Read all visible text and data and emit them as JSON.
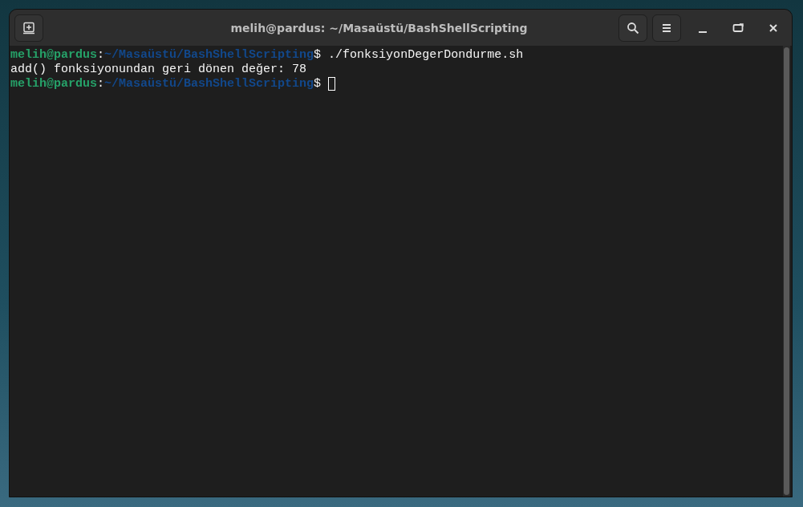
{
  "window": {
    "title": "melih@pardus: ~/Masaüstü/BashShellScripting"
  },
  "terminal": {
    "lines": [
      {
        "kind": "prompt",
        "user": "melih@pardus",
        "separator": ":",
        "path": "~/Masaüstü/BashShellScripting",
        "symbol": "$",
        "command": " ./fonksiyonDegerDondurme.sh"
      },
      {
        "kind": "output",
        "text": "add() fonksiyonundan geri dönen değer: 78"
      },
      {
        "kind": "prompt",
        "user": "melih@pardus",
        "separator": ":",
        "path": "~/Masaüstü/BashShellScripting",
        "symbol": "$",
        "cursor": true
      }
    ]
  }
}
